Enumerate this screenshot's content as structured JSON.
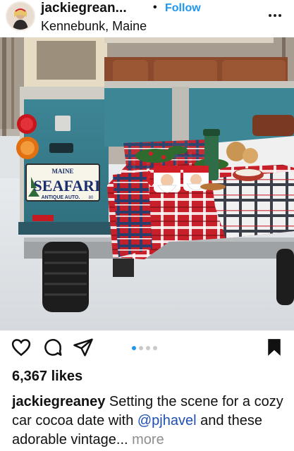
{
  "header": {
    "username": "jackiegrean...",
    "separator": "•",
    "follow_label": "Follow",
    "location": "Kennebunk, Maine",
    "options_icon": "more-horizontal-icon"
  },
  "post": {
    "plate": {
      "state": "MAINE",
      "text": "SEAFARI",
      "subtitle": "ANTIQUE AUTO.",
      "year": "80"
    },
    "carousel": {
      "count": 4,
      "active_index": 1
    }
  },
  "actions": {
    "icons": [
      "heart-icon",
      "comment-icon",
      "share-icon",
      "bookmark-icon"
    ]
  },
  "likes_text": "6,367 likes",
  "caption": {
    "username": "jackiegreaney",
    "text_before": " Setting the scene for a cozy car cocoa date with ",
    "mention": "@pjhavel",
    "text_after": " and these adorable vintage...",
    "more_label": " more"
  },
  "colors": {
    "accent": "#1e97f0",
    "mention": "#1e4fb4",
    "vehicle_teal": "#3a7e8e",
    "muted": "#8e8e8e"
  }
}
